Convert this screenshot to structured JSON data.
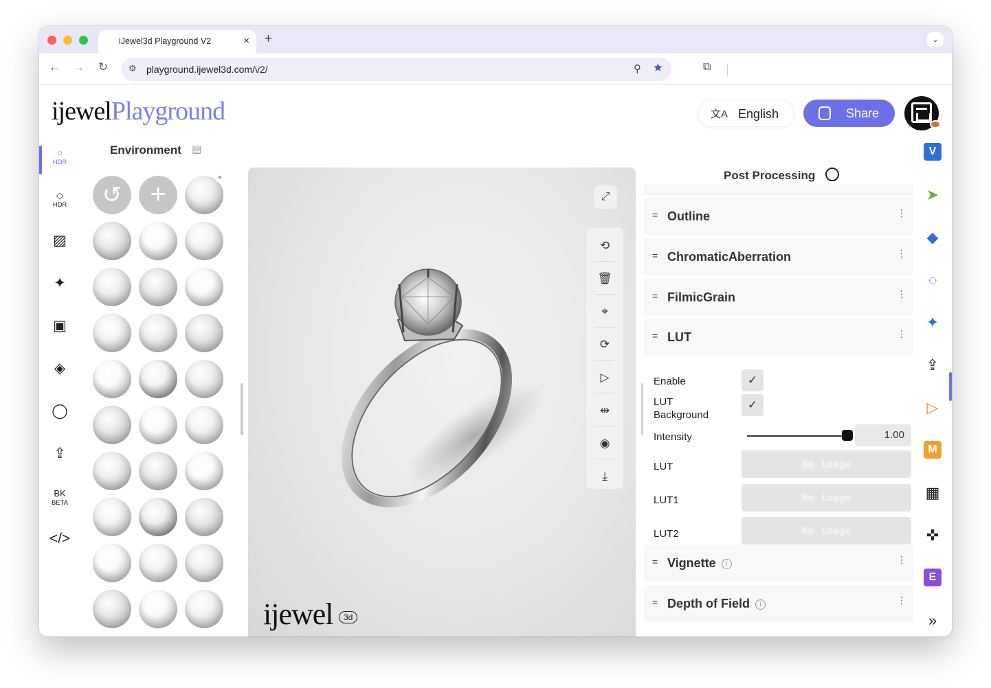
{
  "browser": {
    "tab_title": "iJewel3d Playground V2",
    "tab_close": "×",
    "new_tab": "+",
    "tab_menu": "⌄",
    "url": "playground.ijewel3d.com/v2/",
    "nav": {
      "back": "←",
      "forward": "→",
      "reload": "↻"
    }
  },
  "header": {
    "logo_part1": "ijewel",
    "logo_part2": "Playground",
    "language_label": "English",
    "share_label": "Share"
  },
  "left_rail": {
    "items": [
      {
        "name": "hdr-environment",
        "icon": "○",
        "sub": "HDR"
      },
      {
        "name": "hdr-lights",
        "icon": "◇",
        "sub": "HDR"
      },
      {
        "name": "background",
        "icon": "▨",
        "sub": ""
      },
      {
        "name": "effects",
        "icon": "✦",
        "sub": ""
      },
      {
        "name": "scene-image",
        "icon": "▣",
        "sub": ""
      },
      {
        "name": "ground-plane",
        "icon": "◈",
        "sub": ""
      },
      {
        "name": "ring-materials",
        "icon": "◯",
        "sub": ""
      },
      {
        "name": "export",
        "icon": "⇪",
        "sub": ""
      },
      {
        "name": "bk-beta",
        "icon": "BK",
        "sub": "BETA"
      },
      {
        "name": "embed-code",
        "icon": "</>",
        "sub": ""
      }
    ],
    "collapse": "«"
  },
  "environment": {
    "title": "Environment",
    "reset_icon": "↺",
    "add_icon": "+",
    "remove_icon": "×"
  },
  "viewport": {
    "watermark": "ijewel",
    "watermark_badge": "3d",
    "tools": [
      {
        "name": "rotate-view",
        "icon": "⟲"
      },
      {
        "name": "delete",
        "icon": "🗑"
      },
      {
        "name": "focus",
        "icon": "⌖"
      },
      {
        "name": "auto-rotate",
        "icon": "⟳"
      },
      {
        "name": "play",
        "icon": "▷"
      },
      {
        "name": "reset-camera",
        "icon": "⇹"
      },
      {
        "name": "snapshot",
        "icon": "◉"
      },
      {
        "name": "download",
        "icon": "⤓"
      }
    ],
    "fullscreen_icon": "⤢"
  },
  "post_processing": {
    "title": "Post Processing",
    "sections": [
      {
        "label": "Outline",
        "info": false
      },
      {
        "label": "ChromaticAberration",
        "info": false
      },
      {
        "label": "FilmicGrain",
        "info": false
      },
      {
        "label": "LUT",
        "info": false
      },
      {
        "label": "Vignette",
        "info": true
      },
      {
        "label": "Depth of Field",
        "info": true
      }
    ],
    "lut": {
      "enable_label": "Enable",
      "lut_background_label": "LUT Background",
      "intensity_label": "Intensity",
      "intensity_value": "1.00",
      "intensity": 1.0,
      "lut_label": "LUT",
      "lut1_label": "LUT1",
      "lut2_label": "LUT2",
      "no_image": "No image",
      "check": "✓"
    },
    "info_glyph": "i",
    "kebab": "⋮",
    "drag_handle": "="
  },
  "right_rail": {
    "items": [
      {
        "name": "v-plugin",
        "label": "V",
        "color": "#2f6fd6"
      },
      {
        "name": "pointer-tool",
        "label": "➤",
        "color": "#7aa83a"
      },
      {
        "name": "materials-plugin",
        "label": "◆",
        "color": "#2f6fd6"
      },
      {
        "name": "circle-plugin",
        "label": "◌",
        "color": "#2f6fd6"
      },
      {
        "name": "sparkle-plugin",
        "label": "✦",
        "color": "#2f6fd6"
      },
      {
        "name": "upload-plugin",
        "label": "⇪",
        "color": "#222222"
      },
      {
        "name": "play-plugin",
        "label": "▷",
        "color": "#f08a24"
      },
      {
        "name": "m-plugin",
        "label": "M",
        "color": "#f0a030"
      },
      {
        "name": "grid-plugin",
        "label": "▦",
        "color": "#222222"
      },
      {
        "name": "puzzle-plugin",
        "label": "✜",
        "color": "#222222"
      },
      {
        "name": "e-plugin",
        "label": "E",
        "color": "#8a4fd6"
      },
      {
        "name": "more-plugins",
        "label": "»",
        "color": "#222222"
      }
    ]
  },
  "colors": {
    "accent": "#6b72e8",
    "logo_accent": "#7f7fe6",
    "tabstrip": "#e9e6f7"
  }
}
